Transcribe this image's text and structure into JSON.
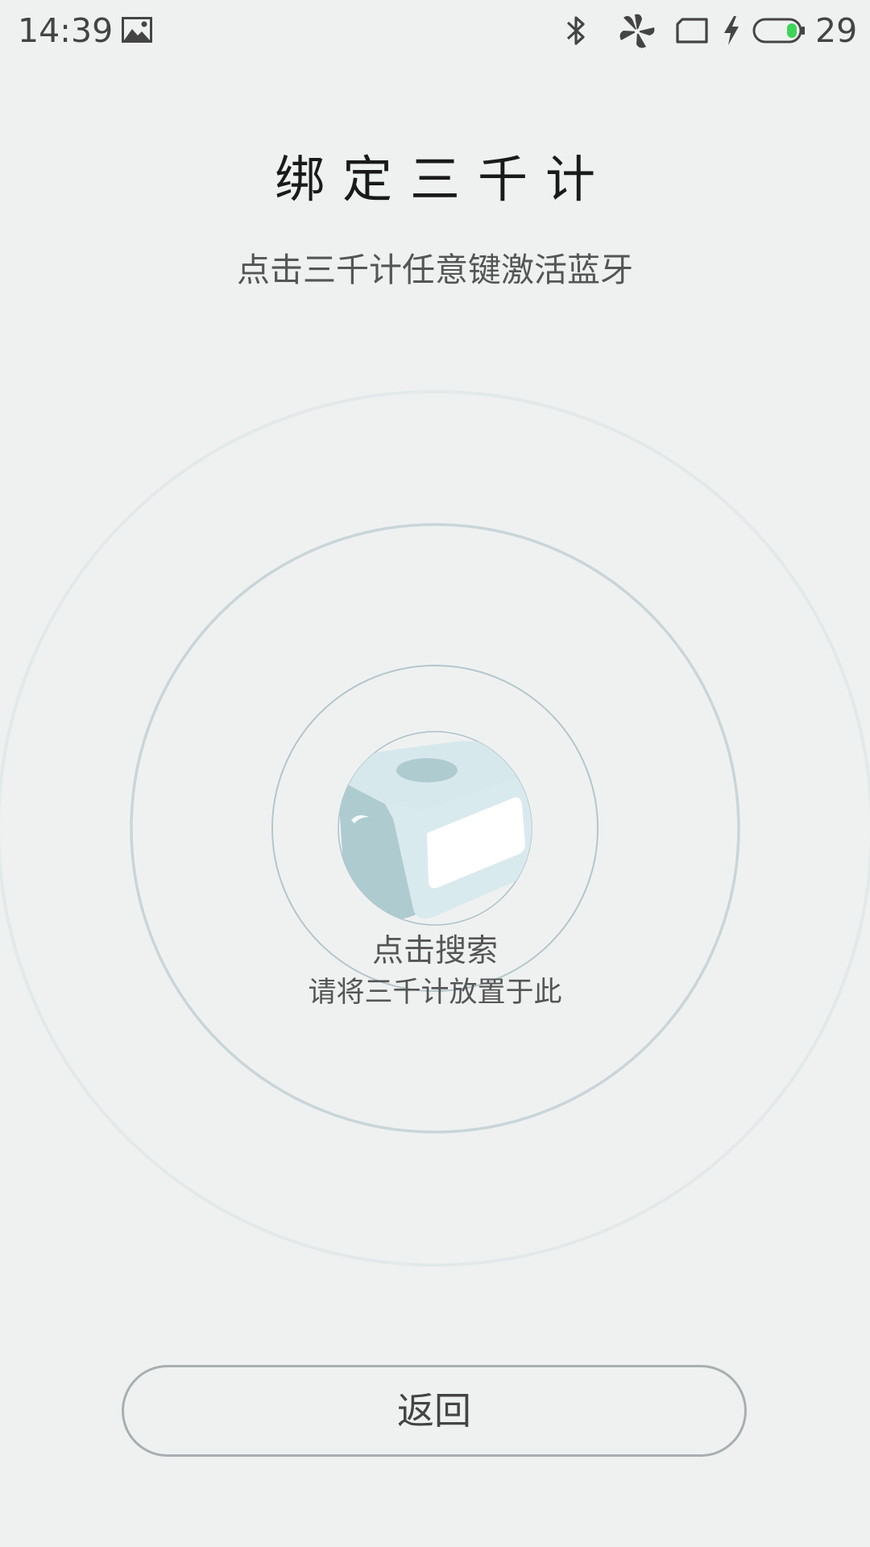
{
  "status_bar": {
    "time": "14:39",
    "battery_level": "29",
    "icons": [
      "gallery-icon",
      "bluetooth-icon",
      "pinwheel-icon",
      "sim-card-icon",
      "charging-icon",
      "battery-icon"
    ],
    "battery_fill_color": "#3dd45a"
  },
  "header": {
    "title": "绑定三千计",
    "subtitle": "点击三千计任意键激活蓝牙"
  },
  "radar": {
    "search_label": "点击搜索",
    "hint": "请将三千计放置于此",
    "ring_color": "#b4c6cc",
    "device_color": "#d6e8ec"
  },
  "footer": {
    "back_label": "返回"
  }
}
